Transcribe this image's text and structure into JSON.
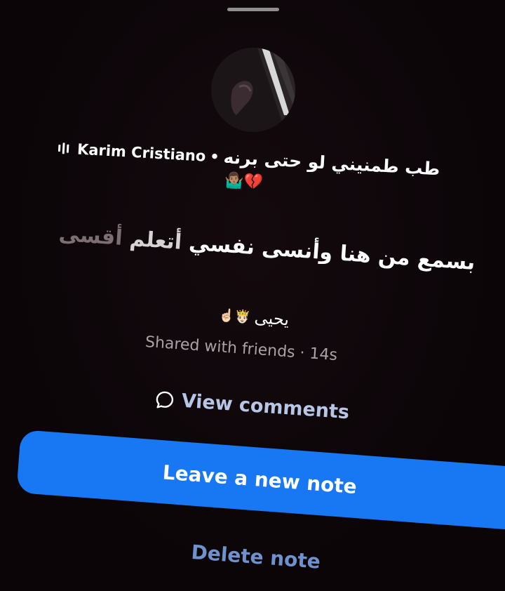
{
  "note": {
    "music": {
      "artist": "Karim Cristiano",
      "separator": "•",
      "song": "طب طمنيني لو حتى برنه",
      "emojis": "🤷🏽‍♂️💔"
    },
    "lyric": {
      "highlighted": "بسمع من هنا وأنسى نفسي",
      "partial": "أتعلم",
      "upcoming": "أقسى"
    },
    "author": {
      "name": "يحيى",
      "emojis": "☝🏻🤴🏻"
    },
    "meta": {
      "audience": "Shared with friends",
      "dot": "·",
      "time": "14s"
    }
  },
  "actions": {
    "view_comments": "View comments",
    "leave_new_note": "Leave a new note",
    "delete_note": "Delete note"
  },
  "colors": {
    "background": "#0b0508",
    "primary_button": "#1877f2",
    "link_text": "#6f92cf"
  }
}
